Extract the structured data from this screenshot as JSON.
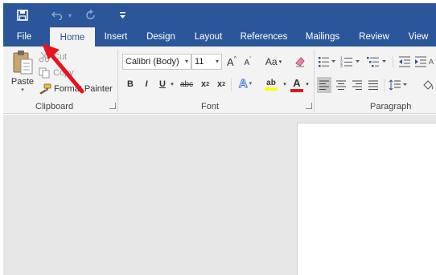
{
  "qat": {
    "save_icon": "save-icon",
    "undo_icon": "undo-icon",
    "redo_icon": "redo-icon",
    "customize_icon": "customize-icon"
  },
  "tabs": [
    {
      "label": "File"
    },
    {
      "label": "Home"
    },
    {
      "label": "Insert"
    },
    {
      "label": "Design"
    },
    {
      "label": "Layout"
    },
    {
      "label": "References"
    },
    {
      "label": "Mailings"
    },
    {
      "label": "Review"
    },
    {
      "label": "View"
    }
  ],
  "clipboard": {
    "paste_label": "Paste",
    "cut_label": "Cut",
    "copy_label": "Copy",
    "format_painter_label": "Format Painter",
    "group_label": "Clipboard"
  },
  "font": {
    "font_name": "Calibri (Body)",
    "font_size": "11",
    "change_case_label": "Aa",
    "bold_label": "B",
    "italic_label": "I",
    "underline_label": "U",
    "strikethrough_label": "abc",
    "subscript_label": "x",
    "subscript_sub": "2",
    "superscript_label": "x",
    "superscript_sup": "2",
    "text_effects_label": "A",
    "font_color_label": "A",
    "highlight_label": "ab",
    "grow_label": "A",
    "shrink_label": "A",
    "group_label": "Font"
  },
  "paragraph": {
    "group_label": "Paragraph"
  },
  "colors": {
    "brand": "#2b579a",
    "ribbon": "#f3f3f3",
    "arrow": "#e8141b",
    "font_color_bar": "#e8141b",
    "highlight_bar": "#ffff00"
  }
}
